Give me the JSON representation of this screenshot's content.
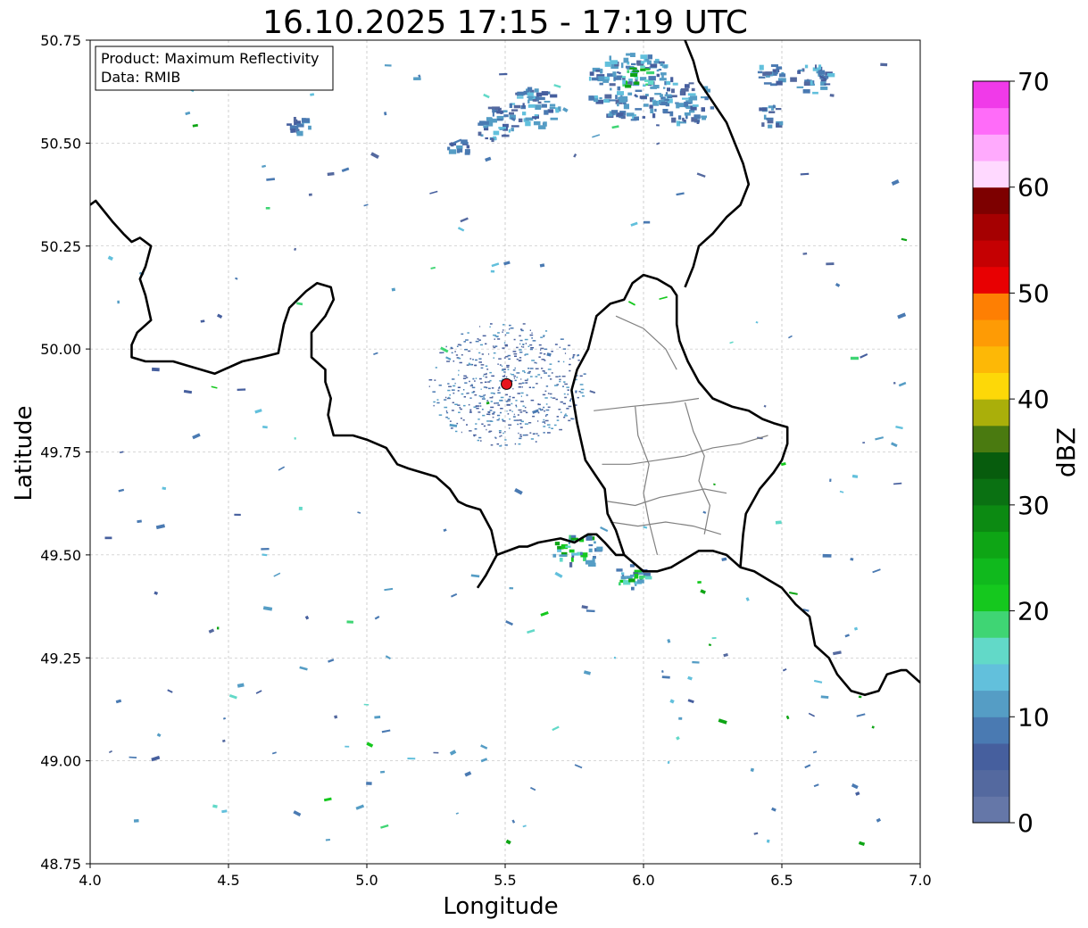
{
  "title": "16.10.2025 17:15 - 17:19 UTC",
  "info_box": {
    "product_line": "Product: Maximum Reflectivity",
    "data_line": "Data: RMIB"
  },
  "axes": {
    "xlabel": "Longitude",
    "ylabel": "Latitude",
    "xlim": [
      4.0,
      7.0
    ],
    "ylim": [
      48.75,
      50.75
    ],
    "xticks": [
      4.0,
      4.5,
      5.0,
      5.5,
      6.0,
      6.5,
      7.0
    ],
    "xtick_labels": [
      "4.0",
      "4.5",
      "5.0",
      "5.5",
      "6.0",
      "6.5",
      "7.0"
    ],
    "yticks": [
      48.75,
      49.0,
      49.25,
      49.5,
      49.75,
      50.0,
      50.25,
      50.5,
      50.75
    ],
    "ytick_labels": [
      "48.75",
      "49.00",
      "49.25",
      "49.50",
      "49.75",
      "50.00",
      "50.25",
      "50.50",
      "50.75"
    ],
    "grid": true
  },
  "radar_site": {
    "lon": 5.505,
    "lat": 49.915,
    "color": "#e8141c"
  },
  "colorbar": {
    "label": "dBZ",
    "min": 0,
    "max": 70,
    "ticks": [
      0,
      10,
      20,
      30,
      40,
      50,
      60,
      70
    ],
    "tick_labels": [
      "0",
      "10",
      "20",
      "30",
      "40",
      "50",
      "60",
      "70"
    ],
    "colors": [
      "#6577a8",
      "#54699f",
      "#465f9e",
      "#4a7ab2",
      "#559dc5",
      "#62c0dc",
      "#62d9c8",
      "#3fd574",
      "#15c81e",
      "#10b91d",
      "#0ea515",
      "#0c8a12",
      "#0a7112",
      "#075c0d",
      "#4a7a10",
      "#aaaf0a",
      "#fdd808",
      "#fdb806",
      "#fe9b05",
      "#fe7f03",
      "#e80002",
      "#c50002",
      "#a50001",
      "#7d0000",
      "#ffd9ff",
      "#ffaafd",
      "#ff6cf9",
      "#f03ae9"
    ]
  },
  "map_features": {
    "borders": [
      [
        [
          4.0,
          50.35
        ],
        [
          4.02,
          50.36
        ],
        [
          4.08,
          50.31
        ],
        [
          4.12,
          50.28
        ],
        [
          4.15,
          50.26
        ],
        [
          4.18,
          50.27
        ],
        [
          4.2,
          50.26
        ],
        [
          4.22,
          50.25
        ],
        [
          4.2,
          50.2
        ],
        [
          4.18,
          50.17
        ],
        [
          4.2,
          50.13
        ],
        [
          4.22,
          50.07
        ],
        [
          4.17,
          50.04
        ],
        [
          4.15,
          50.01
        ],
        [
          4.15,
          49.98
        ],
        [
          4.2,
          49.97
        ],
        [
          4.3,
          49.97
        ],
        [
          4.35,
          49.96
        ],
        [
          4.45,
          49.94
        ],
        [
          4.55,
          49.97
        ],
        [
          4.62,
          49.98
        ],
        [
          4.68,
          49.99
        ],
        [
          4.7,
          50.06
        ],
        [
          4.72,
          50.1
        ],
        [
          4.78,
          50.14
        ],
        [
          4.82,
          50.16
        ],
        [
          4.87,
          50.15
        ],
        [
          4.88,
          50.12
        ],
        [
          4.85,
          50.08
        ],
        [
          4.8,
          50.04
        ],
        [
          4.8,
          49.98
        ],
        [
          4.85,
          49.95
        ],
        [
          4.85,
          49.92
        ],
        [
          4.87,
          49.88
        ],
        [
          4.86,
          49.84
        ],
        [
          4.88,
          49.79
        ],
        [
          4.95,
          49.79
        ],
        [
          5.0,
          49.78
        ],
        [
          5.07,
          49.76
        ],
        [
          5.11,
          49.72
        ],
        [
          5.15,
          49.71
        ],
        [
          5.2,
          49.7
        ],
        [
          5.25,
          49.69
        ],
        [
          5.3,
          49.66
        ],
        [
          5.32,
          49.64
        ],
        [
          5.33,
          49.63
        ],
        [
          5.36,
          49.62
        ],
        [
          5.41,
          49.61
        ],
        [
          5.45,
          49.56
        ],
        [
          5.47,
          49.5
        ],
        [
          5.55,
          49.52
        ],
        [
          5.58,
          49.52
        ],
        [
          5.62,
          49.53
        ],
        [
          5.7,
          49.54
        ],
        [
          5.75,
          49.53
        ],
        [
          5.8,
          49.55
        ],
        [
          5.83,
          49.55
        ],
        [
          5.86,
          49.53
        ],
        [
          5.9,
          49.5
        ],
        [
          5.93,
          49.5
        ],
        [
          6.0,
          49.46
        ],
        [
          6.05,
          49.46
        ],
        [
          6.1,
          49.47
        ],
        [
          6.15,
          49.49
        ],
        [
          6.2,
          49.51
        ],
        [
          6.25,
          49.51
        ],
        [
          6.3,
          49.5
        ],
        [
          6.35,
          49.47
        ],
        [
          6.4,
          49.46
        ],
        [
          6.45,
          49.44
        ],
        [
          6.5,
          49.42
        ],
        [
          6.55,
          49.38
        ],
        [
          6.6,
          49.35
        ],
        [
          6.62,
          49.28
        ],
        [
          6.67,
          49.25
        ],
        [
          6.7,
          49.21
        ],
        [
          6.75,
          49.17
        ],
        [
          6.8,
          49.16
        ],
        [
          6.85,
          49.17
        ],
        [
          6.88,
          49.21
        ],
        [
          6.93,
          49.22
        ],
        [
          6.95,
          49.22
        ],
        [
          7.0,
          49.19
        ]
      ],
      [
        [
          5.47,
          49.5
        ],
        [
          5.43,
          49.45
        ],
        [
          5.4,
          49.42
        ]
      ],
      [
        [
          6.35,
          49.47
        ],
        [
          6.36,
          49.55
        ],
        [
          6.37,
          49.6
        ],
        [
          6.42,
          49.66
        ],
        [
          6.47,
          49.7
        ],
        [
          6.5,
          49.73
        ],
        [
          6.52,
          49.77
        ],
        [
          6.52,
          49.81
        ],
        [
          6.47,
          49.82
        ],
        [
          6.43,
          49.83
        ],
        [
          6.38,
          49.85
        ],
        [
          6.32,
          49.86
        ],
        [
          6.25,
          49.88
        ],
        [
          6.2,
          49.92
        ],
        [
          6.16,
          49.97
        ],
        [
          6.13,
          50.02
        ],
        [
          6.12,
          50.06
        ],
        [
          6.12,
          50.13
        ],
        [
          6.1,
          50.15
        ],
        [
          6.05,
          50.17
        ],
        [
          6.0,
          50.18
        ],
        [
          5.96,
          50.16
        ],
        [
          5.93,
          50.12
        ],
        [
          5.88,
          50.11
        ],
        [
          5.83,
          50.08
        ],
        [
          5.8,
          50.0
        ],
        [
          5.76,
          49.95
        ],
        [
          5.74,
          49.9
        ],
        [
          5.75,
          49.86
        ],
        [
          5.76,
          49.82
        ],
        [
          5.79,
          49.73
        ],
        [
          5.82,
          49.7
        ],
        [
          5.86,
          49.66
        ],
        [
          5.87,
          49.6
        ],
        [
          5.9,
          49.56
        ],
        [
          5.93,
          49.5
        ]
      ],
      [
        [
          6.15,
          50.15
        ],
        [
          6.18,
          50.2
        ],
        [
          6.2,
          50.25
        ],
        [
          6.25,
          50.28
        ],
        [
          6.3,
          50.32
        ],
        [
          6.35,
          50.35
        ],
        [
          6.38,
          50.4
        ],
        [
          6.36,
          50.45
        ],
        [
          6.33,
          50.5
        ],
        [
          6.3,
          50.55
        ],
        [
          6.25,
          50.6
        ],
        [
          6.2,
          50.65
        ],
        [
          6.18,
          50.7
        ],
        [
          6.15,
          50.75
        ]
      ]
    ],
    "internal_borders": [
      [
        [
          5.82,
          49.85
        ],
        [
          5.95,
          49.86
        ],
        [
          6.1,
          49.87
        ],
        [
          6.2,
          49.88
        ]
      ],
      [
        [
          5.85,
          49.72
        ],
        [
          5.95,
          49.72
        ],
        [
          6.05,
          49.73
        ],
        [
          6.15,
          49.74
        ],
        [
          6.25,
          49.76
        ],
        [
          6.35,
          49.77
        ],
        [
          6.45,
          49.79
        ]
      ],
      [
        [
          5.87,
          49.63
        ],
        [
          5.97,
          49.62
        ],
        [
          6.06,
          49.64
        ],
        [
          6.14,
          49.65
        ],
        [
          6.22,
          49.66
        ],
        [
          6.3,
          49.65
        ]
      ],
      [
        [
          5.88,
          49.58
        ],
        [
          5.98,
          49.57
        ],
        [
          6.08,
          49.58
        ],
        [
          6.18,
          49.57
        ],
        [
          6.28,
          49.55
        ]
      ],
      [
        [
          5.97,
          49.86
        ],
        [
          5.98,
          49.79
        ],
        [
          6.02,
          49.72
        ],
        [
          6.0,
          49.65
        ],
        [
          6.02,
          49.58
        ],
        [
          6.05,
          49.5
        ]
      ],
      [
        [
          6.15,
          49.87
        ],
        [
          6.18,
          49.8
        ],
        [
          6.22,
          49.74
        ],
        [
          6.2,
          49.68
        ],
        [
          6.24,
          49.62
        ],
        [
          6.22,
          49.55
        ]
      ],
      [
        [
          5.9,
          50.08
        ],
        [
          6.0,
          50.05
        ],
        [
          6.08,
          50.0
        ],
        [
          6.12,
          49.95
        ]
      ]
    ]
  }
}
